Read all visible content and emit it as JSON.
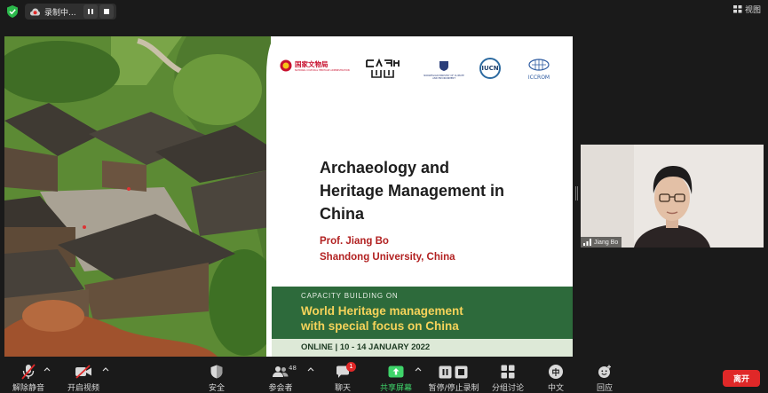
{
  "top_bar": {
    "recording_label": "录制中...",
    "view_label": "视图"
  },
  "slide": {
    "logos": {
      "ncha_text": "国家文物局",
      "ncha_subtext": "NATIONAL CULTURAL HERITAGE ADMINISTRATION",
      "norway_text": "NORWEGIAN MINISTRY OF CLIMATE AND ENVIRONMENT",
      "iucn_text": "IUCN",
      "iccrom_text": "ICCROM"
    },
    "title_lines": [
      "Archaeology and",
      "Heritage Management in",
      "China"
    ],
    "presenter": "Prof. Jiang Bo",
    "affiliation": "Shandong University, China",
    "band_kicker": "CAPACITY BUILDING ON",
    "band_title_1": "World Heritage management",
    "band_title_2": "with special focus on China",
    "band_date": "ONLINE |  10 - 14 JANUARY 2022"
  },
  "video": {
    "participant_name": "Jiang Bo"
  },
  "toolbar": {
    "unmute": "解除静音",
    "start_video": "开启视频",
    "security": "安全",
    "participants": "参会者",
    "participants_count": "48",
    "chat": "聊天",
    "chat_badge": "1",
    "share": "共享屏幕",
    "pause_recording": "暂停/停止录制",
    "breakout": "分组讨论",
    "language": "中文",
    "language_glyph": "中",
    "reactions": "回应",
    "leave": "离开"
  },
  "colors": {
    "background": "#1a1a1a",
    "green_band": "#2d6a3b",
    "band_title": "#f5d35a",
    "presenter": "#b22222",
    "share_green": "#3fd46a",
    "leave_red": "#e02828"
  }
}
